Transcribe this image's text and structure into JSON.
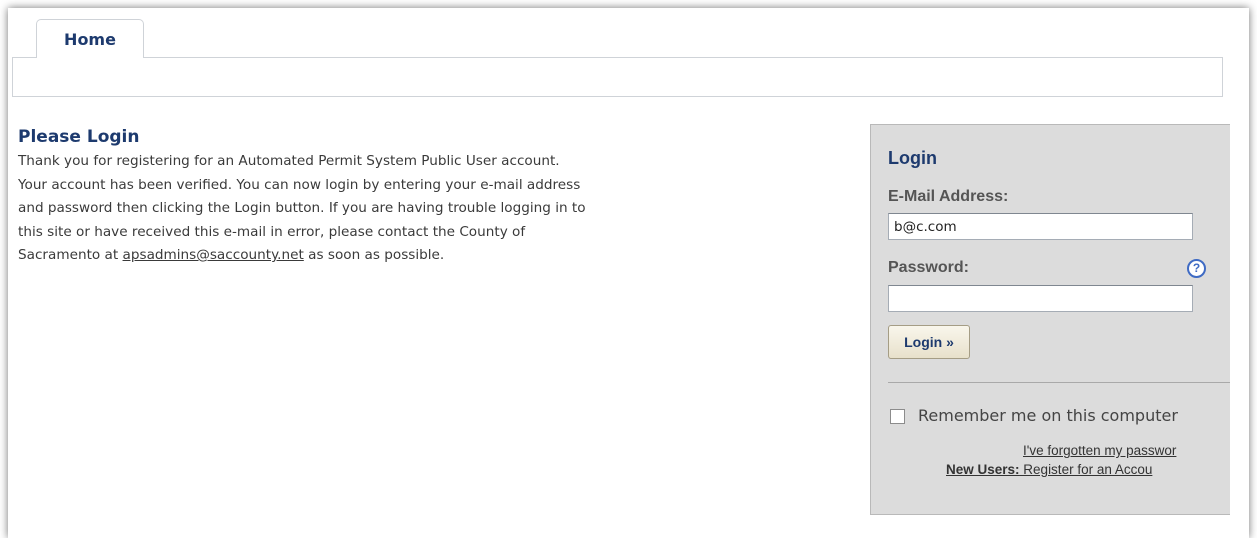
{
  "tabs": [
    {
      "label": "Home"
    }
  ],
  "main": {
    "title": "Please Login",
    "message_lines": [
      "Thank you for registering for an Automated Permit System Public User account.",
      "Your account has been verified. You can now login by entering your e-mail address",
      "and password then clicking the Login button. If you are having trouble logging in to",
      "this site or have received this e-mail in error, please contact the County of"
    ],
    "message_last_prefix": "Sacramento at ",
    "contact_email": "apsadmins@saccounty.net",
    "message_last_suffix": " as soon as possible."
  },
  "login": {
    "title": "Login",
    "email_label": "E-Mail Address:",
    "email_value": "b@c.com",
    "password_label": "Password:",
    "password_value": "",
    "help_icon": "?",
    "login_button": "Login »",
    "remember_label": "Remember me on this computer",
    "remember_checked": false,
    "forgot_link": "I've forgotten my passwor",
    "new_users_label": "New Users:",
    "register_link": " Register for an Accou"
  },
  "colors": {
    "accent": "#1d3a6e",
    "login_panel_bg": "#dcdcdc",
    "help_icon": "#3f6bc4"
  }
}
